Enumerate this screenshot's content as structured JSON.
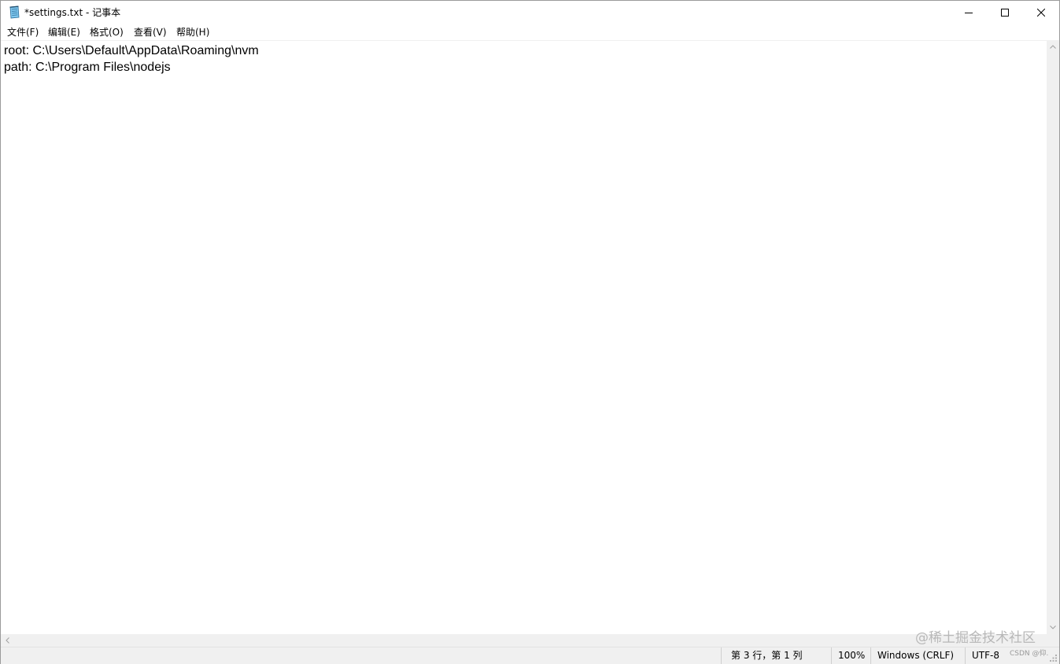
{
  "window": {
    "title": "*settings.txt - 记事本",
    "controls": {
      "minimize": "minimize",
      "maximize": "maximize",
      "close": "close"
    }
  },
  "menu": {
    "items": [
      {
        "label": "文件(F)"
      },
      {
        "label": "编辑(E)"
      },
      {
        "label": "格式(O)"
      },
      {
        "label": "查看(V)"
      },
      {
        "label": "帮助(H)"
      }
    ]
  },
  "editor": {
    "lines": [
      "root: C:\\Users\\Default\\AppData\\Roaming\\nvm",
      "path: C:\\Program Files\\nodejs"
    ]
  },
  "status": {
    "position": "第 3 行，第 1 列",
    "zoom": "100%",
    "line_ending": "Windows (CRLF)",
    "encoding": "UTF-8"
  },
  "watermark": {
    "main": "@稀土掘金技术社区",
    "small": "CSDN @仰."
  },
  "icons": {
    "app": "notepad-icon",
    "minimize": "minimize-icon",
    "maximize": "maximize-icon",
    "close": "close-icon"
  },
  "colors": {
    "chrome": "#f0f0f0",
    "text": "#000000",
    "background": "#ffffff"
  }
}
